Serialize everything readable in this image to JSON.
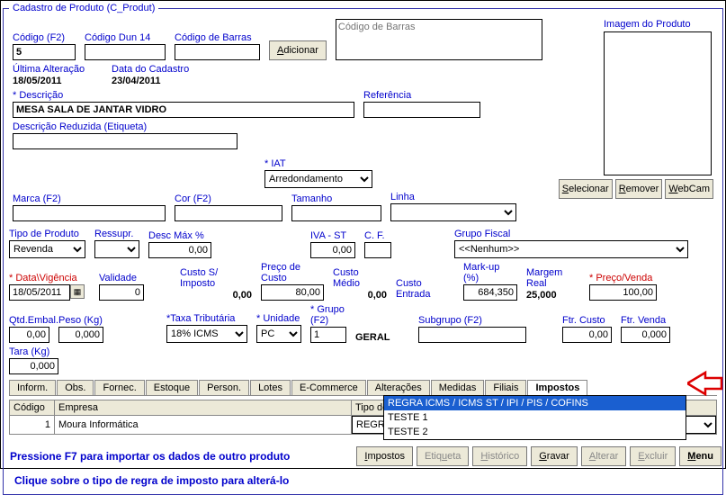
{
  "window_title": "Cadastro de Produto (C_Produt)",
  "codigo": {
    "label": "Código (F2)",
    "value": "5"
  },
  "codigo_dun": {
    "label": "Código Dun 14",
    "value": ""
  },
  "codigo_barras": {
    "label": "Código de Barras",
    "value": ""
  },
  "adicionar_btn": "Adicionar",
  "barcode_box_placeholder": "Código de Barras",
  "ultima_alteracao": {
    "label": "Última Alteração",
    "value": "18/05/2011"
  },
  "data_cadastro": {
    "label": "Data do Cadastro",
    "value": "23/04/2011"
  },
  "descricao": {
    "label": "* Descrição",
    "value": "MESA SALA DE JANTAR VIDRO"
  },
  "referencia": {
    "label": "Referência",
    "value": ""
  },
  "desc_reduzida": {
    "label": "Descrição Reduzida (Etiqueta)",
    "value": ""
  },
  "iat": {
    "label": "* IAT",
    "value": "Arredondamento"
  },
  "marca": {
    "label": "Marca (F2)",
    "value": ""
  },
  "cor": {
    "label": "Cor (F2)",
    "value": ""
  },
  "tamanho": {
    "label": "Tamanho",
    "value": ""
  },
  "linha": {
    "label": "Linha",
    "value": ""
  },
  "imagem_title": "Imagem do Produto",
  "img_btns": {
    "selecionar": "Selecionar",
    "remover": "Remover",
    "webcam": "WebCam"
  },
  "tipo_produto": {
    "label": "Tipo de Produto",
    "value": "Revenda"
  },
  "ressupr": {
    "label": "Ressupr.",
    "value": ""
  },
  "desc_max": {
    "label": "Desc Máx %",
    "value": "0,00"
  },
  "iva_st": {
    "label": "IVA - ST",
    "value": "0,00"
  },
  "cf": {
    "label": "C. F.",
    "value": ""
  },
  "grupo_fiscal": {
    "label": "Grupo Fiscal",
    "value": "<<Nenhum>>"
  },
  "data_vigencia": {
    "label": "* Data\\Vigência",
    "value": "18/05/2011"
  },
  "validade": {
    "label": "Validade",
    "value": "0"
  },
  "custo_si": {
    "label": "Custo S/ Imposto",
    "value": "0,00"
  },
  "preco_custo": {
    "label": "Preço de Custo",
    "value": "80,00"
  },
  "custo_medio": {
    "label": "Custo Médio",
    "value": "0,00"
  },
  "custo_entrada": {
    "label": "Custo Entrada",
    "value": ""
  },
  "markup": {
    "label": "Mark-up (%)",
    "value": "684,350"
  },
  "margem_real": {
    "label": "Margem Real",
    "value": "25,000"
  },
  "preco_venda": {
    "label": "* Preço/Venda",
    "value": "100,00"
  },
  "qtd_embal": {
    "label": "Qtd.Embal.",
    "value": "0,00"
  },
  "peso": {
    "label": "Peso (Kg)",
    "value": "0,000"
  },
  "taxa_trib": {
    "label": "*Taxa Tributária",
    "value": "18% ICMS"
  },
  "unidade": {
    "label": "* Unidade",
    "value": "PC"
  },
  "grupo": {
    "label": "* Grupo (F2)",
    "value": "1",
    "gvalue": "GERAL"
  },
  "subgrupo": {
    "label": "Subgrupo (F2)",
    "value": ""
  },
  "ftr_custo": {
    "label": "Ftr. Custo",
    "value": "0,00"
  },
  "ftr_venda": {
    "label": "Ftr. Venda",
    "value": "0,000"
  },
  "tara": {
    "label": "Tara (Kg)",
    "value": "0,000"
  },
  "tabs": [
    "Inform.",
    "Obs.",
    "Fornec.",
    "Estoque",
    "Person.",
    "Lotes",
    "E-Commerce",
    "Alterações",
    "Medidas",
    "Filiais",
    "Impostos"
  ],
  "active_tab": "Impostos",
  "grid": {
    "cols": [
      "Código",
      "Empresa",
      "Tipo de Regra de Imposto"
    ],
    "row": {
      "codigo": "1",
      "empresa": "Moura Informática",
      "regra": "REGRA ICMS / ICMS ST / IPI / PIS / COFINS"
    }
  },
  "dropdown_options": [
    "REGRA ICMS / ICMS ST / IPI / PIS / COFINS",
    "TESTE 1",
    "TESTE 2"
  ],
  "dropdown_selected": "REGRA ICMS / ICMS ST / IPI / PIS / COFINS",
  "grid_hint": "Clique sobre o tipo de regra de imposto para alterá-lo",
  "footer_hint": "Pressione F7 para importar os dados de outro produto",
  "footer_btns": [
    "Impostos",
    "Etiqueta",
    "Histórico",
    "Gravar",
    "Alterar",
    "Excluir",
    "Menu"
  ]
}
